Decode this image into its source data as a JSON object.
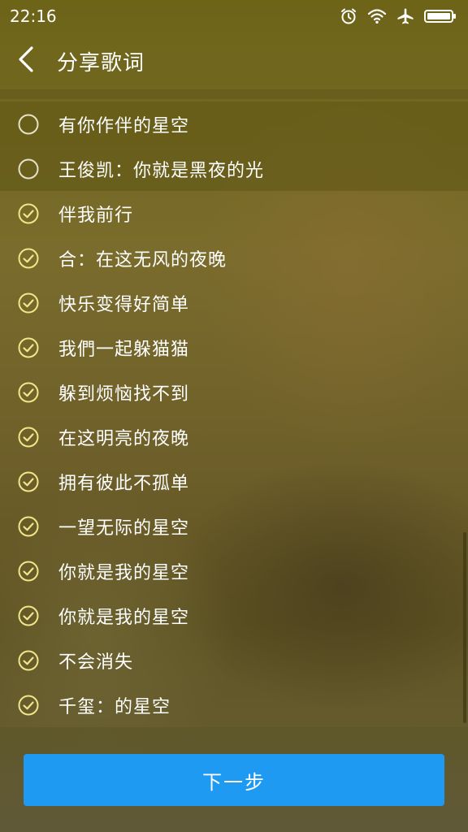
{
  "status_bar": {
    "time": "22:16",
    "icons": [
      "alarm-icon",
      "wifi-icon",
      "airplane-mode-icon",
      "battery-icon"
    ]
  },
  "header": {
    "title": "分享歌词",
    "back_icon": "chevron-left-icon"
  },
  "lyrics": [
    {
      "text": "有你作伴的星空",
      "checked": false
    },
    {
      "text": "王俊凯：你就是黑夜的光",
      "checked": false
    },
    {
      "text": "伴我前行",
      "checked": true
    },
    {
      "text": "合：在这无风的夜晚",
      "checked": true
    },
    {
      "text": "快乐变得好简单",
      "checked": true
    },
    {
      "text": "我們一起躲猫猫",
      "checked": true
    },
    {
      "text": "躲到烦恼找不到",
      "checked": true
    },
    {
      "text": "在这明亮的夜晚",
      "checked": true
    },
    {
      "text": "拥有彼此不孤单",
      "checked": true
    },
    {
      "text": "一望无际的星空",
      "checked": true
    },
    {
      "text": "你就是我的星空",
      "checked": true
    },
    {
      "text": "你就是我的星空",
      "checked": true
    },
    {
      "text": "不会消失",
      "checked": true
    },
    {
      "text": "千玺：的星空",
      "checked": true
    }
  ],
  "footer": {
    "next_label": "下一步"
  },
  "colors": {
    "accent": "#1e9af2",
    "checked": "#f2e58a",
    "unchecked": "#e6e2c8"
  }
}
